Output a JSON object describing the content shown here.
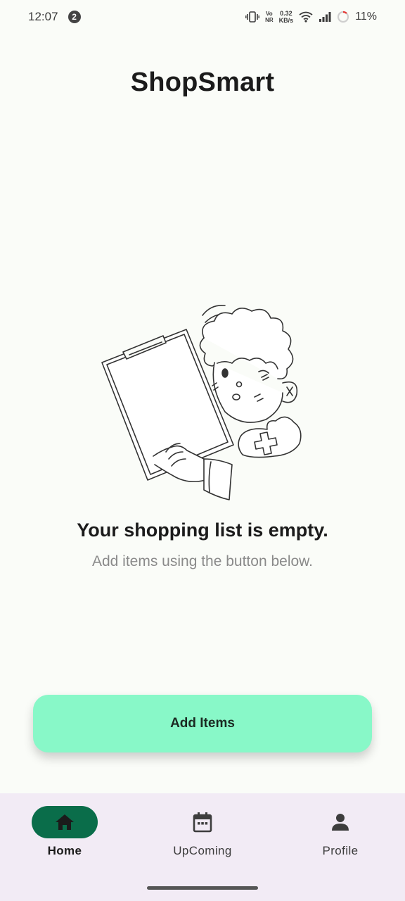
{
  "status_bar": {
    "time": "12:07",
    "notification_count": "2",
    "volte_top": "Vo",
    "volte_bottom": "NR",
    "net_speed_value": "0.32",
    "net_speed_unit": "KB/s",
    "battery": "11%"
  },
  "app": {
    "title": "ShopSmart"
  },
  "empty_state": {
    "heading": "Your shopping list is empty.",
    "subtext": "Add items using the  button below."
  },
  "actions": {
    "add_items_label": "Add Items"
  },
  "bottom_nav": {
    "items": [
      {
        "label": "Home",
        "icon": "home-icon",
        "selected": true
      },
      {
        "label": "UpComing",
        "icon": "calendar-icon",
        "selected": false
      },
      {
        "label": "Profile",
        "icon": "person-icon",
        "selected": false
      }
    ]
  },
  "colors": {
    "background": "#fafcf8",
    "primary_button": "#88f8c8",
    "nav_selected": "#0a6d4a",
    "nav_background": "#f2ebf5"
  }
}
